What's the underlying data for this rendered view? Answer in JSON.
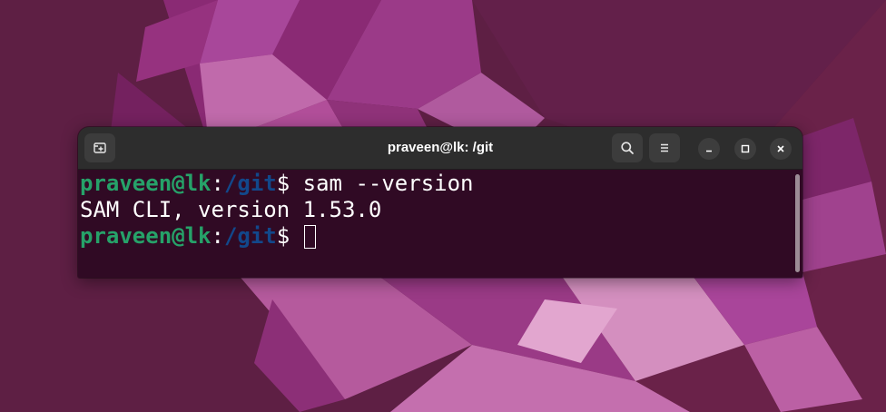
{
  "window": {
    "title": "praveen@lk: /git"
  },
  "headerbar": {
    "new_tab_icon": "new-tab-icon",
    "search_icon": "search-icon",
    "menu_icon": "hamburger-menu-icon",
    "minimize_icon": "minimize-icon",
    "maximize_icon": "maximize-icon",
    "close_icon": "close-icon"
  },
  "terminal": {
    "lines": [
      {
        "user": "praveen@lk",
        "sep": ":",
        "path": "/git",
        "prompt": "$ ",
        "command": "sam --version"
      },
      {
        "output": "SAM CLI, version 1.53.0"
      },
      {
        "user": "praveen@lk",
        "sep": ":",
        "path": "/git",
        "prompt": "$ ",
        "command": ""
      }
    ]
  },
  "colors": {
    "terminal_bg": "#300a24",
    "prompt_user": "#26a269",
    "prompt_path": "#12488b",
    "headerbar_bg": "#2d2d2d",
    "desktop_bg": "#5e1f44"
  }
}
